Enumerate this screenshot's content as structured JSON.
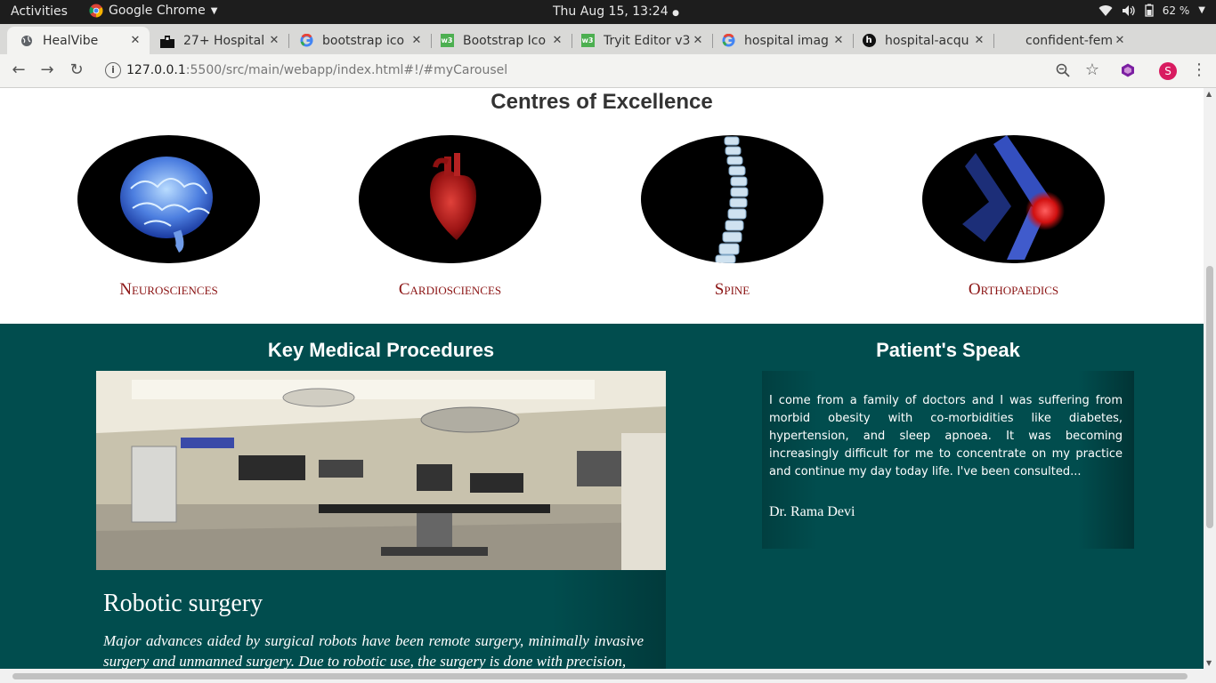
{
  "os": {
    "activities": "Activities",
    "app_name": "Google Chrome",
    "clock": "Thu Aug 15, 13:24",
    "battery": "62 %"
  },
  "browser": {
    "tabs": [
      {
        "title": "HealVibe"
      },
      {
        "title": "27+ Hospital"
      },
      {
        "title": "bootstrap ico"
      },
      {
        "title": "Bootstrap Ico"
      },
      {
        "title": "Tryit Editor v3"
      },
      {
        "title": "hospital imag"
      },
      {
        "title": "hospital-acqu"
      },
      {
        "title": "confident-fem"
      }
    ],
    "url_host": "127.0.0.1",
    "url_path": ":5500/src/main/webapp/index.html#!/#myCarousel",
    "profile_initial": "S"
  },
  "page": {
    "coe_title": "Centres of Excellence",
    "centres": [
      {
        "label": "Neurosciences",
        "icon": "brain"
      },
      {
        "label": "Cardiosciences",
        "icon": "heart"
      },
      {
        "label": "Spine",
        "icon": "spine"
      },
      {
        "label": "Orthopaedics",
        "icon": "knee"
      }
    ],
    "procedures_title": "Key Medical Procedures",
    "procedure_heading": "Robotic surgery",
    "procedure_text": "Major advances aided by surgical robots have been remote surgery, minimally invasive surgery and unmanned surgery. Due to robotic use, the surgery is done with precision,",
    "patients_title": "Patient's Speak",
    "testimonial": "I come from a family of doctors and I was suffering from morbid obesity with co-morbidities like diabetes, hypertension, and sleep apnoea. It was becoming increasingly difficult for me to concentrate on my practice and continue my day today life. I've been consulted...",
    "testimonial_author": "Dr. Rama Devi"
  },
  "colors": {
    "teal": "#014d4e",
    "label_red": "#8b1414"
  }
}
